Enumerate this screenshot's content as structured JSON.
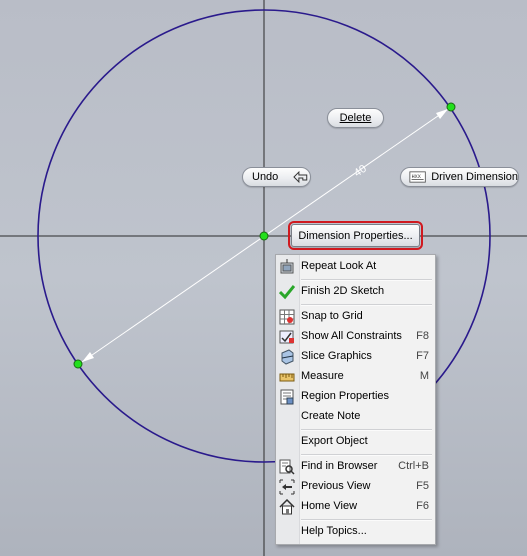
{
  "sketch": {
    "dimension_value": "40",
    "colors": {
      "circle": "#2a1a8c",
      "axes": "#2b2b2b",
      "dimension_line": "#ffffff",
      "point_fill": "#22e01c",
      "highlight_outline": "#d0191f"
    }
  },
  "heads_up": {
    "delete_label": "Delete",
    "undo_label": "Undo",
    "driven_dimension_label": "Driven Dimension",
    "dimension_properties_label": "Dimension Properties..."
  },
  "context_menu": {
    "items": [
      {
        "label": "Repeat Look At",
        "shortcut": "",
        "icon": "look-at-icon"
      },
      {
        "label": "Finish 2D Sketch",
        "shortcut": "",
        "icon": "checkmark-icon"
      },
      {
        "label": "Snap to Grid",
        "shortcut": "",
        "icon": "grid-snap-icon"
      },
      {
        "label": "Show All Constraints",
        "shortcut": "F8",
        "icon": "constraints-icon"
      },
      {
        "label": "Slice Graphics",
        "shortcut": "F7",
        "icon": "slice-graphics-icon"
      },
      {
        "label": "Measure",
        "shortcut": "M",
        "icon": "ruler-icon"
      },
      {
        "label": "Region Properties",
        "shortcut": "",
        "icon": "region-properties-icon"
      },
      {
        "label": "Create Note",
        "shortcut": "",
        "icon": ""
      },
      {
        "label": "Export Object",
        "shortcut": "",
        "icon": ""
      },
      {
        "label": "Find in Browser",
        "shortcut": "Ctrl+B",
        "icon": "find-in-browser-icon"
      },
      {
        "label": "Previous View",
        "shortcut": "F5",
        "icon": "previous-view-icon"
      },
      {
        "label": "Home View",
        "shortcut": "F6",
        "icon": "home-icon"
      },
      {
        "label": "Help Topics...",
        "shortcut": "",
        "icon": ""
      }
    ]
  }
}
